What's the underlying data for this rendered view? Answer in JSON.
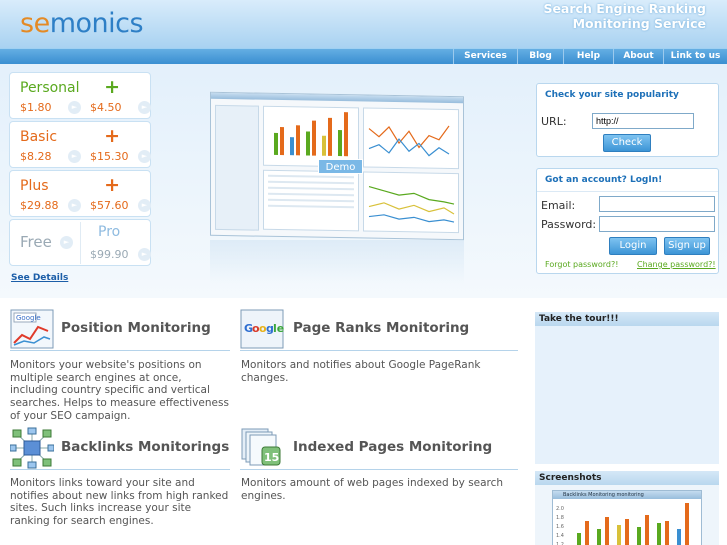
{
  "header": {
    "logo_prefix": "se",
    "logo_rest": "monics",
    "tagline_line1": "Search Engine Ranking",
    "tagline_line2": "Monitoring Service"
  },
  "nav": [
    {
      "label": "Services"
    },
    {
      "label": "Blog"
    },
    {
      "label": "Help"
    },
    {
      "label": "About"
    },
    {
      "label": "Link to us"
    }
  ],
  "plans": [
    {
      "name": "Personal",
      "price_monthly": "$1.80",
      "price_yearly": "$4.50",
      "color": "#5aa91f"
    },
    {
      "name": "Basic",
      "price_monthly": "$8.28",
      "price_yearly": "$15.30",
      "color": "#e46a1b"
    },
    {
      "name": "Plus",
      "price_monthly": "$29.88",
      "price_yearly": "$57.60",
      "color": "#e46a1b"
    },
    {
      "name": "Free",
      "pro_name": "Pro",
      "pro_price": "$99.90",
      "color": "#9aa9b4"
    }
  ],
  "plan_plus_symbol": "+",
  "see_details": "See Details",
  "demo_label": "Demo",
  "popularity": {
    "title": "Check your site popularity",
    "url_label": "URL:",
    "url_value": "http://",
    "check_button": "Check"
  },
  "login": {
    "title": "Got an account? LogIn!",
    "email_label": "Email:",
    "password_label": "Password:",
    "login_button": "Login",
    "signup_button": "Sign up",
    "forgot_link": "Forgot password?!",
    "change_link": "Change password?!"
  },
  "features": [
    {
      "title": "Position Monitoring",
      "icon": "google-search-chart-icon",
      "desc": "Monitors your website's positions on multiple search engines at once, including country specific and vertical searches. Helps to measure effectiveness of your SEO campaign."
    },
    {
      "title": "Page Ranks Monitoring",
      "icon": "google-pagerank-icon",
      "desc": "Monitors and notifies about Google PageRank changes."
    },
    {
      "title": "Backlinks Monitorings",
      "icon": "network-links-icon",
      "desc": "Monitors links toward your site and notifies about new links from high ranked sites. Such links increase your site ranking for search engines."
    },
    {
      "title": "Indexed Pages Monitoring",
      "icon": "indexed-pages-icon",
      "desc": "Monitors amount of web pages indexed by search engines."
    }
  ],
  "sidebar": {
    "tour_title": "Take the tour!!!",
    "screenshots_title": "Screenshots",
    "thumb_caption": "Backlinks Monitoring monitoring"
  },
  "colors": {
    "accent": "#3a8fd1",
    "orange": "#e46a1b",
    "green": "#5aa91f"
  }
}
